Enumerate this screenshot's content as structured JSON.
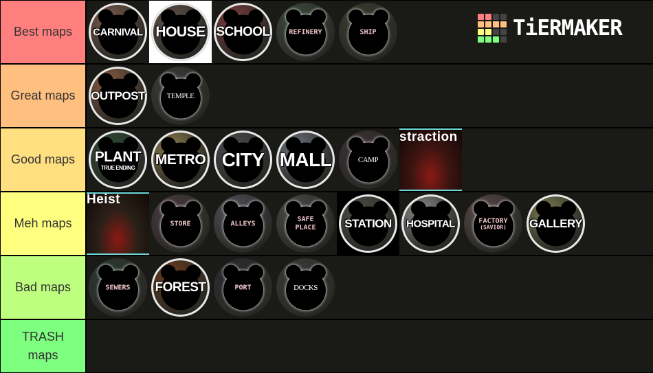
{
  "brand": {
    "name": "TiERMAKER",
    "grid_colors": [
      "#ff7f7f",
      "#ff7f7f",
      "#444444",
      "#444444",
      "#ffbf7f",
      "#ffbf7f",
      "#ffbf7f",
      "#ffbf7f",
      "#ffff7f",
      "#ffff7f",
      "#444444",
      "#444444",
      "#7fff7f",
      "#7fff7f",
      "#7fff7f",
      "#444444"
    ]
  },
  "tiers": [
    {
      "label": "Best maps",
      "color": "#ff7f7f",
      "items": [
        {
          "name": "CARNIVAL",
          "style": "bold",
          "bg": "#7a5a4a"
        },
        {
          "name": "HOUSE",
          "style": "bold",
          "bg": "#5e5048",
          "frame": "white"
        },
        {
          "name": "SCHOOL",
          "style": "bold",
          "bg": "#7a3a3a"
        },
        {
          "name": "REFINERY",
          "style": "red",
          "bg": "#3c4a3c"
        },
        {
          "name": "SHIP",
          "style": "red",
          "bg": "#3a3a30"
        }
      ]
    },
    {
      "label": "Great maps",
      "color": "#ffbf7f",
      "items": [
        {
          "name": "OUTPOST",
          "style": "bold",
          "bg": "#8a5a40"
        },
        {
          "name": "TEMPLE",
          "style": "serif",
          "bg": "#3a3a3a"
        }
      ]
    },
    {
      "label": "Good maps",
      "color": "#ffdf7f",
      "items": [
        {
          "name": "PLANT",
          "sub": "TRUE ENDING",
          "style": "bold",
          "bg": "#2c4a34"
        },
        {
          "name": "METRO",
          "style": "bold",
          "bg": "#8a7a4a"
        },
        {
          "name": "CITY",
          "style": "bold",
          "bg": "#4a4a50"
        },
        {
          "name": "MALL",
          "style": "bold",
          "bg": "#6a7078"
        },
        {
          "name": "CAMP",
          "style": "serif",
          "bg": "#3a3036"
        },
        {
          "name": "Distraction",
          "style": "thumb",
          "caption": "straction",
          "bg": "#3a1410"
        }
      ]
    },
    {
      "label": "Meh maps",
      "color": "#ffff7f",
      "items": [
        {
          "name": "Heist",
          "style": "thumb",
          "caption": "Heist",
          "bg": "#2a2018"
        },
        {
          "name": "STORE",
          "style": "red",
          "bg": "#4a3a40"
        },
        {
          "name": "ALLEYS",
          "style": "red",
          "bg": "#50525a"
        },
        {
          "name": "SAFE PLACE",
          "style": "red",
          "bg": "#4a4a48"
        },
        {
          "name": "STATION",
          "style": "bold",
          "bg": "#4a4e44",
          "frame": "black"
        },
        {
          "name": "HOSPITAL",
          "style": "bold",
          "bg": "#8a8a8a"
        },
        {
          "name": "FACTORY",
          "sub": "(SAVIOR)",
          "style": "red",
          "bg": "#5a4a4a"
        },
        {
          "name": "GALLERY",
          "style": "bold",
          "bg": "#7a7a50"
        }
      ]
    },
    {
      "label": "Bad maps",
      "color": "#bfff7f",
      "items": [
        {
          "name": "SEWERS",
          "style": "red",
          "bg": "#2a3a30"
        },
        {
          "name": "FOREST",
          "style": "bold",
          "bg": "#6a3a1a"
        },
        {
          "name": "PORT",
          "style": "red",
          "bg": "#2a2a30"
        },
        {
          "name": "DOCKS",
          "style": "serif",
          "bg": "#3a3a3a"
        }
      ]
    },
    {
      "label": "TRASH maps",
      "color": "#7fff7f",
      "items": []
    }
  ]
}
